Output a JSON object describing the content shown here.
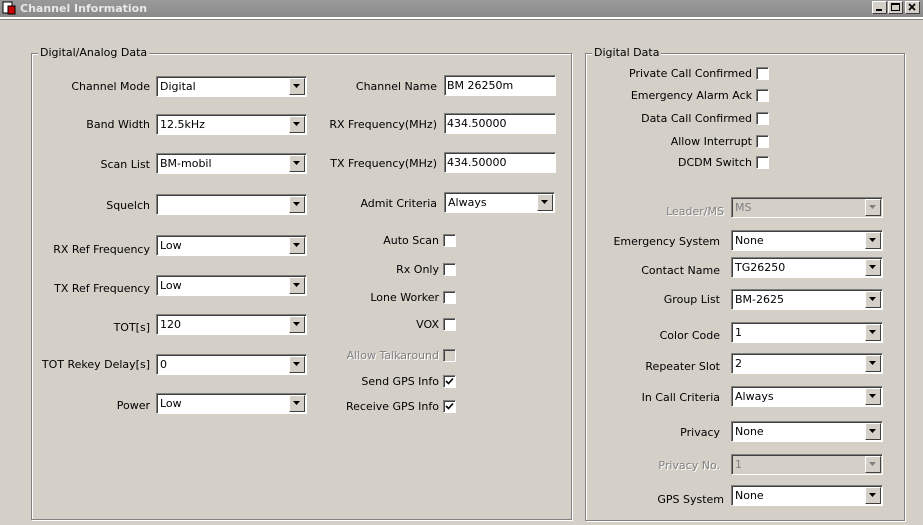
{
  "window": {
    "title": "Channel Information"
  },
  "digital_analog": {
    "legend": "Digital/Analog Data",
    "channel_mode": {
      "label": "Channel Mode",
      "value": "Digital"
    },
    "band_width": {
      "label": "Band Width",
      "value": "12.5kHz"
    },
    "scan_list": {
      "label": "Scan List",
      "value": "BM-mobil"
    },
    "squelch": {
      "label": "Squelch",
      "value": ""
    },
    "rx_ref_frequency": {
      "label": "RX Ref Frequency",
      "value": "Low"
    },
    "tx_ref_frequency": {
      "label": "TX Ref Frequency",
      "value": "Low"
    },
    "tot": {
      "label": "TOT[s]",
      "value": "120"
    },
    "tot_rekey_delay": {
      "label": "TOT Rekey Delay[s]",
      "value": "0"
    },
    "power": {
      "label": "Power",
      "value": "Low"
    },
    "channel_name": {
      "label": "Channel Name",
      "value": "BM 26250m"
    },
    "rx_frequency": {
      "label": "RX Frequency(MHz)",
      "value": "434.50000"
    },
    "tx_frequency": {
      "label": "TX Frequency(MHz)",
      "value": "434.50000"
    },
    "admit_criteria": {
      "label": "Admit Criteria",
      "value": "Always"
    },
    "auto_scan": {
      "label": "Auto Scan",
      "checked": false
    },
    "rx_only": {
      "label": "Rx Only",
      "checked": false
    },
    "lone_worker": {
      "label": "Lone Worker",
      "checked": false
    },
    "vox": {
      "label": "VOX",
      "checked": false
    },
    "allow_talkaround": {
      "label": "Allow Talkaround",
      "checked": false,
      "disabled": true
    },
    "send_gps_info": {
      "label": "Send GPS Info",
      "checked": true
    },
    "receive_gps_info": {
      "label": "Receive GPS Info",
      "checked": true
    }
  },
  "digital": {
    "legend": "Digital Data",
    "private_call_confirmed": {
      "label": "Private Call Confirmed",
      "checked": false
    },
    "emergency_alarm_ack": {
      "label": "Emergency Alarm Ack",
      "checked": false
    },
    "data_call_confirmed": {
      "label": "Data Call Confirmed",
      "checked": false
    },
    "allow_interrupt": {
      "label": "Allow Interrupt",
      "checked": false
    },
    "dcdm_switch": {
      "label": "DCDM Switch",
      "checked": false
    },
    "leader_ms": {
      "label": "Leader/MS",
      "value": "MS",
      "disabled": true
    },
    "emergency_system": {
      "label": "Emergency System",
      "value": "None"
    },
    "contact_name": {
      "label": "Contact Name",
      "value": "TG26250"
    },
    "group_list": {
      "label": "Group List",
      "value": "BM-2625"
    },
    "color_code": {
      "label": "Color Code",
      "value": "1"
    },
    "repeater_slot": {
      "label": "Repeater Slot",
      "value": "2"
    },
    "in_call_criteria": {
      "label": "In Call Criteria",
      "value": "Always"
    },
    "privacy": {
      "label": "Privacy",
      "value": "None"
    },
    "privacy_no": {
      "label": "Privacy No.",
      "value": "1",
      "disabled": true
    },
    "gps_system": {
      "label": "GPS System",
      "value": "None"
    }
  }
}
